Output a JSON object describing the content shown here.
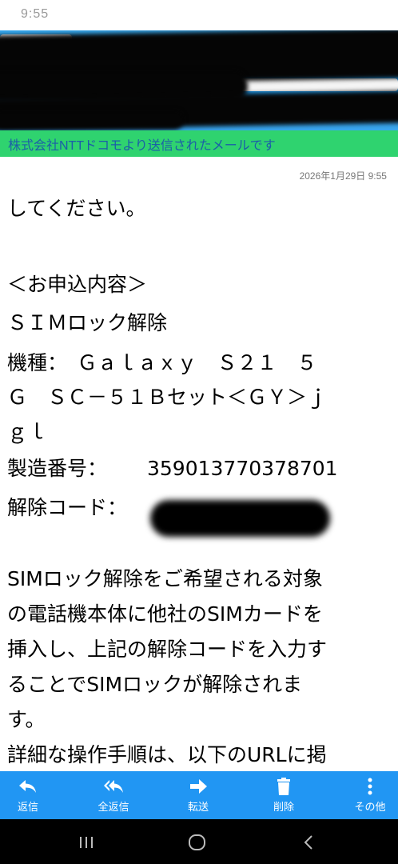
{
  "status": {
    "time": "9:55"
  },
  "banner": {
    "text": "株式会社NTTドコモより送信されたメールです"
  },
  "mail": {
    "timestamp": "2026年1月29日 9:55",
    "lines": [
      "してください。",
      "＜お申込内容＞",
      "ＳＩＭロック解除",
      "機種：　Ｇａｌａｘｙ　Ｓ２１　５",
      "Ｇ　ＳＣ－５１Ｂセット＜ＧＹ＞ｊ",
      "ｇｌ",
      "製造番号：",
      "解除コード：",
      "SIMロック解除をご希望される対象",
      "の電話機本体に他社のSIMカードを",
      "挿入し、上記の解除コードを入力す",
      "ることでSIMロックが解除されま",
      "す。",
      "詳細な操作手順は、以下のURLに掲"
    ],
    "serial_number": "359013770378701"
  },
  "actions": [
    {
      "label": "返信",
      "icon": "reply-icon"
    },
    {
      "label": "全返信",
      "icon": "reply-all-icon"
    },
    {
      "label": "転送",
      "icon": "forward-icon"
    },
    {
      "label": "削除",
      "icon": "trash-icon"
    },
    {
      "label": "その他",
      "icon": "more-vertical-icon"
    }
  ],
  "nav": {
    "icons": [
      "recent-apps-icon",
      "home-icon",
      "back-icon"
    ]
  },
  "colors": {
    "header_blue": "#1e96e6",
    "banner_green": "#2fd36f",
    "banner_text": "#1b5ea8",
    "action_bar": "#2196f3"
  }
}
